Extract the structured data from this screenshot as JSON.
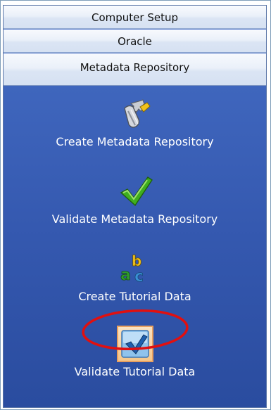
{
  "sections": {
    "computer_setup": "Computer Setup",
    "oracle": "Oracle",
    "metadata_repository": "Metadata Repository"
  },
  "tasks": [
    {
      "label": "Create Metadata Repository",
      "icon": "tools-icon"
    },
    {
      "label": "Validate Metadata Repository",
      "icon": "green-checkmark-icon"
    },
    {
      "label": "Create Tutorial Data",
      "icon": "abc-letters-icon"
    },
    {
      "label": "Validate Tutorial Data",
      "icon": "blue-checkbox-icon"
    }
  ],
  "colors": {
    "panel_background": "#3f66bd",
    "highlight_ring": "#e01010",
    "selected_box": "#f4c68a"
  }
}
